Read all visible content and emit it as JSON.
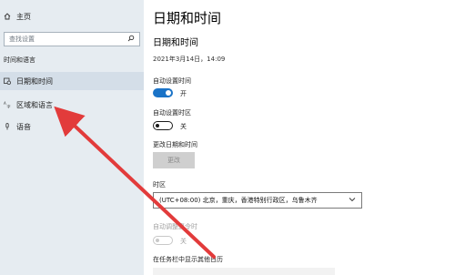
{
  "sidebar": {
    "home": {
      "label": "主页",
      "icon": "home-icon"
    },
    "search": {
      "placeholder": "查找设置",
      "icon": "search-icon"
    },
    "section": "时间和语言",
    "items": [
      {
        "label": "日期和时间",
        "icon": "calendar-clock-icon"
      },
      {
        "label": "区域和语言",
        "icon": "language-icon"
      },
      {
        "label": "语音",
        "icon": "microphone-icon"
      }
    ]
  },
  "main": {
    "title": "日期和时间",
    "subtitle": "日期和时间",
    "current_datetime": "2021年3月14日，14:09",
    "auto_time": {
      "label": "自动设置时间",
      "state_text": "开",
      "on": true
    },
    "auto_timezone": {
      "label": "自动设置时区",
      "state_text": "关",
      "on": false
    },
    "change_datetime": {
      "label": "更改日期和时间",
      "button": "更改"
    },
    "timezone": {
      "label": "时区",
      "value": "(UTC+08:00) 北京，重庆，香港特别行政区，乌鲁木齐",
      "icon": "chevron-down-icon"
    },
    "dst": {
      "label": "自动调整夏令时",
      "state_text": "关",
      "on": false,
      "disabled": true
    },
    "taskbar_calendar": {
      "label": "在任务栏中显示其他日历"
    }
  },
  "colors": {
    "sidebar_bg": "#e6ecf1",
    "accent": "#1a73c7",
    "annotation_arrow": "#e23b3b"
  }
}
